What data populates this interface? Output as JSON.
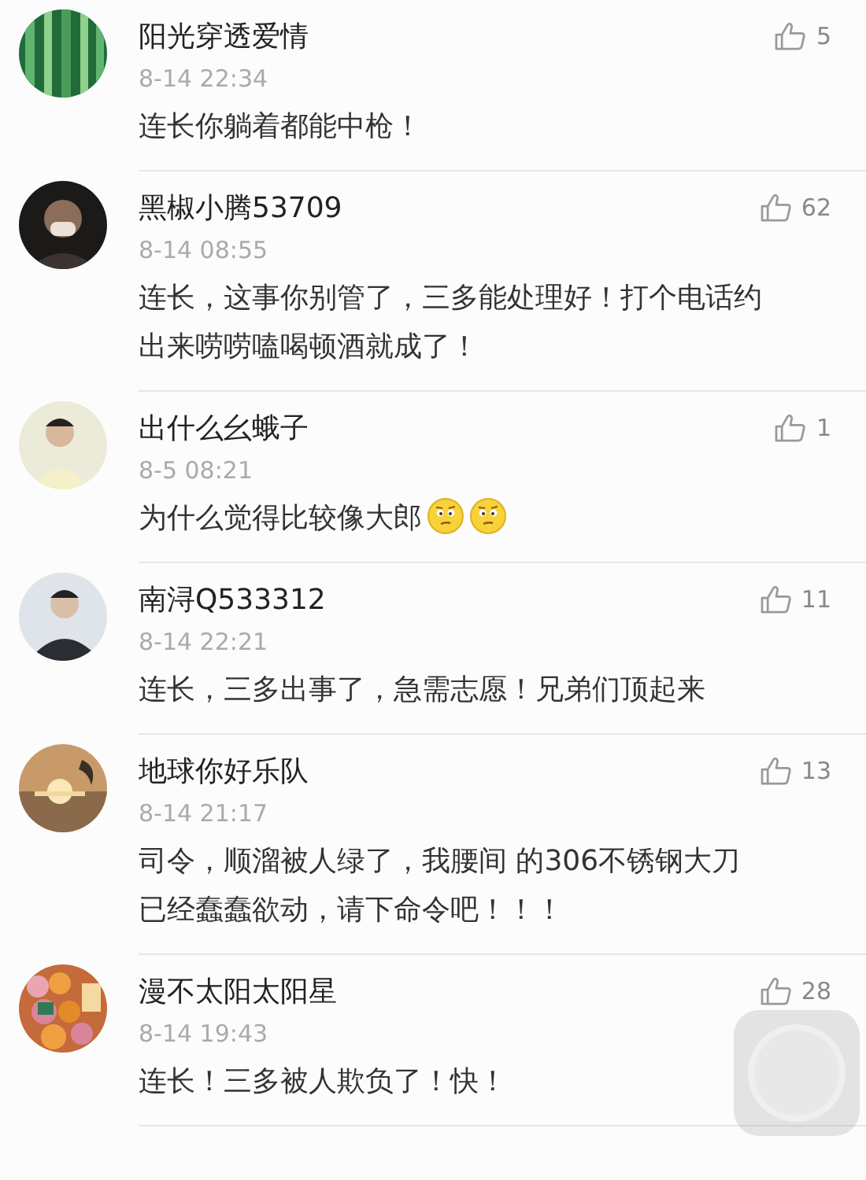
{
  "comments": [
    {
      "name": "阳光穿透爱情",
      "time": "8-14 22:34",
      "text": "连长你躺着都能中枪！",
      "likes": "5"
    },
    {
      "name": "黑椒小腾53709",
      "time": "8-14 08:55",
      "text": "连长，这事你别管了，三多能处理好！打个电话约出来唠唠嗑喝顿酒就成了！",
      "likes": "62"
    },
    {
      "name": "出什么幺蛾子",
      "time": "8-5 08:21",
      "text": "为什么觉得比较像大郎",
      "likes": "1",
      "emojis": [
        {
          "kind": "thinking"
        },
        {
          "kind": "thinking"
        }
      ]
    },
    {
      "name": "南浔Q533312",
      "time": "8-14 22:21",
      "text": "连长，三多出事了，急需志愿！兄弟们顶起来",
      "likes": "11"
    },
    {
      "name": "地球你好乐队",
      "time": "8-14 21:17",
      "text": "司令，顺溜被人绿了，我腰间 的306不锈钢大刀已经蠢蠢欲动，请下命令吧！！！",
      "likes": "13"
    },
    {
      "name": "漫不太阳太阳星",
      "time": "8-14 19:43",
      "text": "连长！三多被人欺负了！快！",
      "likes": "28"
    }
  ]
}
